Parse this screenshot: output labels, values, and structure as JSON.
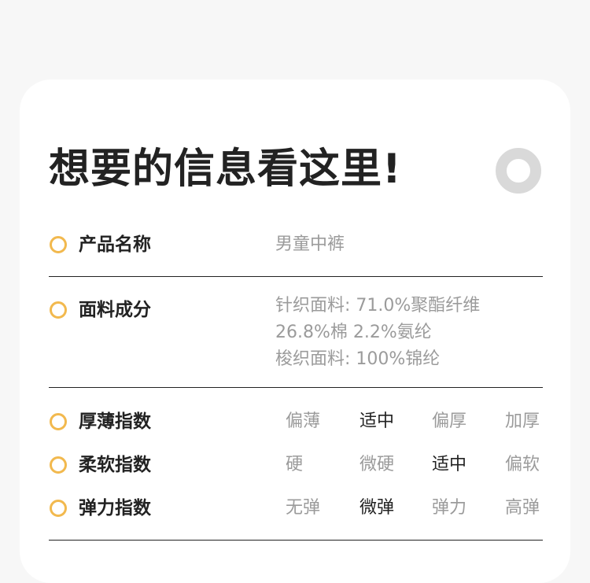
{
  "title": "想要的信息看这里!",
  "colors": {
    "accent": "#f2b94e",
    "muted": "#9b9b9b",
    "dark": "#222222",
    "ring": "#d9d9d9"
  },
  "icons": {
    "decor": "ring-icon",
    "bullet": "circle-bullet-icon"
  },
  "product_name": {
    "label": "产品名称",
    "value": "男童中裤"
  },
  "fabric": {
    "label": "面料成分",
    "lines": [
      "针织面料: 71.0%聚酯纤维",
      "26.8%棉 2.2%氨纶",
      "梭织面料: 100%锦纶"
    ]
  },
  "indices": [
    {
      "label": "厚薄指数",
      "options": [
        "偏薄",
        "适中",
        "偏厚",
        "加厚"
      ],
      "selected": "适中"
    },
    {
      "label": "柔软指数",
      "options": [
        "硬",
        "微硬",
        "适中",
        "偏软"
      ],
      "selected": "适中"
    },
    {
      "label": "弹力指数",
      "options": [
        "无弹",
        "微弹",
        "弹力",
        "高弹"
      ],
      "selected": "微弹"
    }
  ]
}
